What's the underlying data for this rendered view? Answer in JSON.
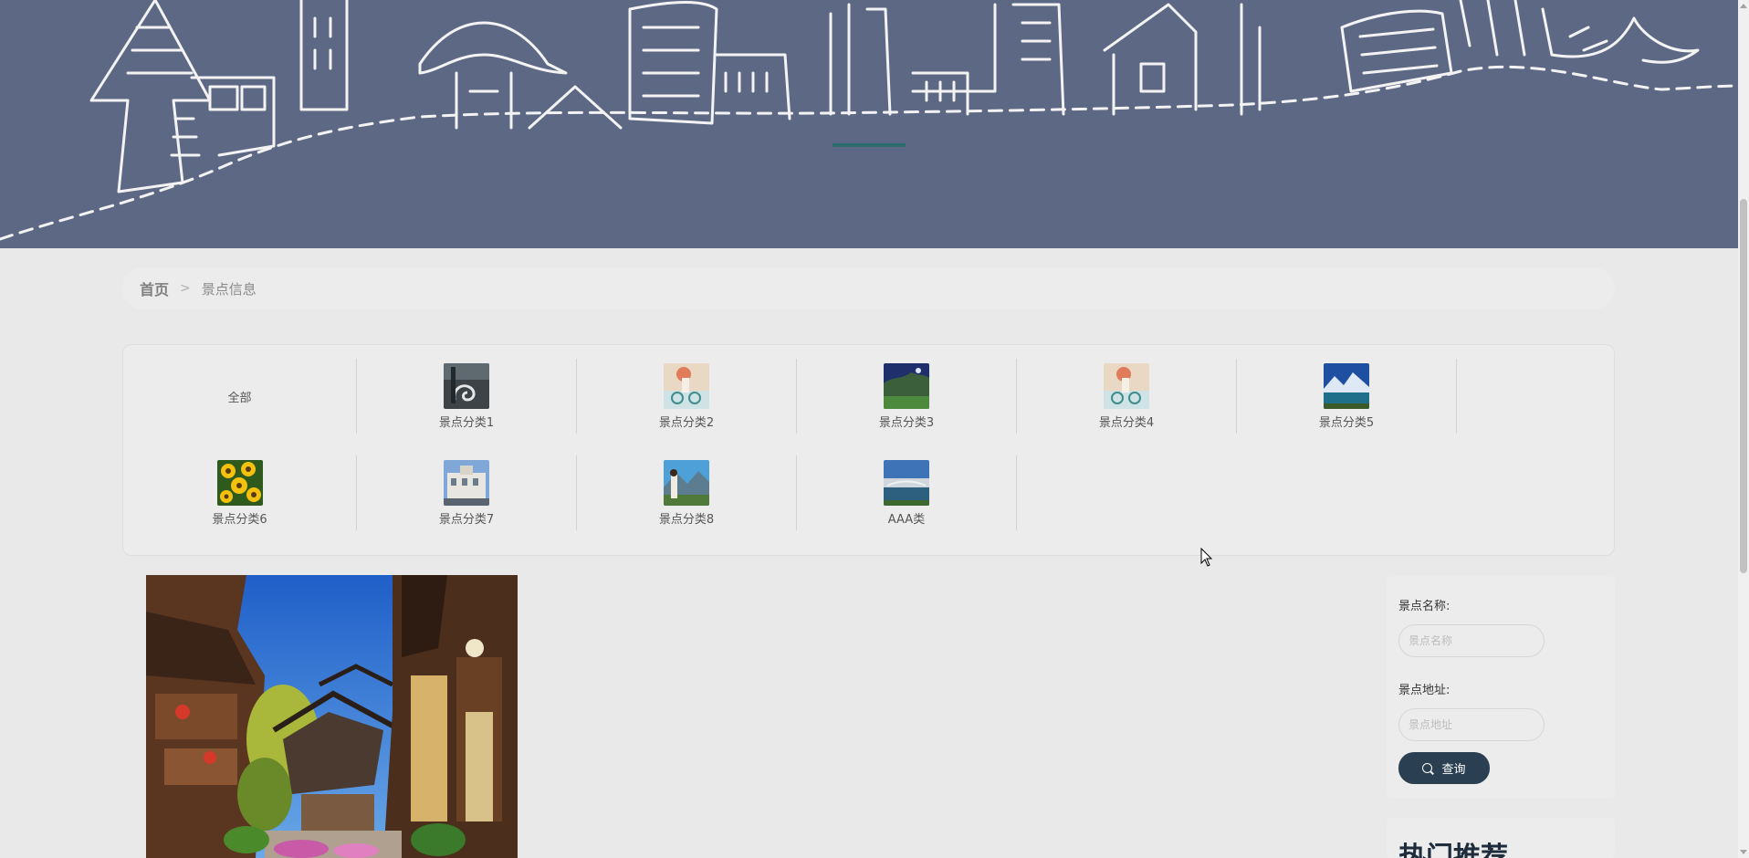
{
  "breadcrumb": {
    "home": "首页",
    "separator": ">",
    "current": "景点信息"
  },
  "categories": {
    "all_label": "全部",
    "items": [
      {
        "label": "景点分类1",
        "thumb": "stone-sculpture"
      },
      {
        "label": "景点分类2",
        "thumb": "girl-bicycle"
      },
      {
        "label": "景点分类3",
        "thumb": "night-landscape"
      },
      {
        "label": "景点分类4",
        "thumb": "girl-bicycle"
      },
      {
        "label": "景点分类5",
        "thumb": "mountain-lake"
      },
      {
        "label": "景点分类6",
        "thumb": "sunflowers"
      },
      {
        "label": "景点分类7",
        "thumb": "city-building"
      },
      {
        "label": "景点分类8",
        "thumb": "girl-mountains"
      },
      {
        "label": "AAA类",
        "thumb": "waterfront"
      }
    ]
  },
  "search": {
    "name_label": "景点名称:",
    "name_placeholder": "景点名称",
    "address_label": "景点地址:",
    "address_placeholder": "景点地址",
    "button_label": "查询"
  },
  "hot": {
    "title": "热门推荐"
  },
  "colors": {
    "banner": "#5c6884",
    "accent": "#2a3f51",
    "indicator": "#2a6b6e",
    "page_bg": "#e9e9e9"
  }
}
